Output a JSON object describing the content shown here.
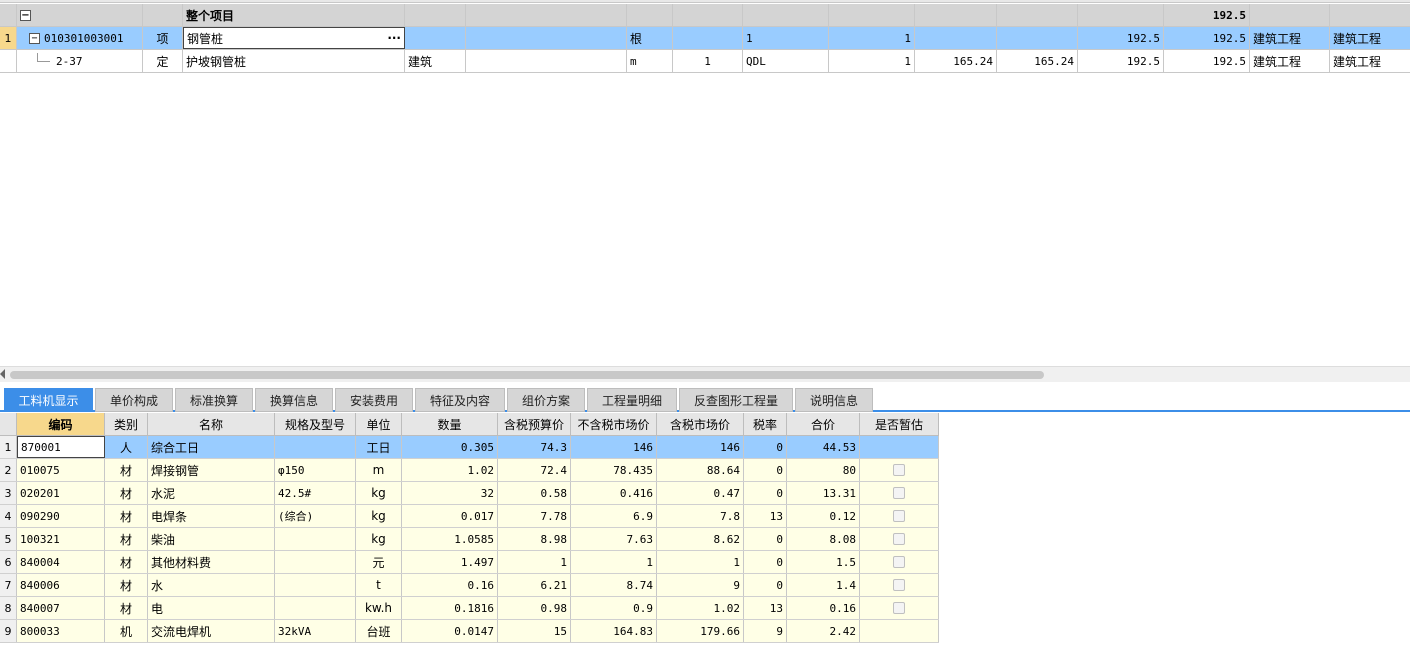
{
  "top_grid": {
    "summary_row": {
      "name": "整个项目",
      "total": "192.5"
    },
    "rows": [
      {
        "num": "1",
        "code": "010301003001",
        "type": "项",
        "name": "钢管桩",
        "ellipsis": "···",
        "spec": "",
        "extra": "",
        "unit": "根",
        "qty_expr": "",
        "qty": "1",
        "qty2": "1",
        "p1": "",
        "p2": "",
        "p3": "192.5",
        "p4": "192.5",
        "cat1": "建筑工程",
        "cat2": "建筑工程"
      },
      {
        "num": "",
        "code": "2-37",
        "type": "定",
        "name": "护坡钢管桩",
        "ellipsis": "",
        "spec": "建筑",
        "extra": "",
        "unit": "m",
        "qty_expr": "1",
        "qty": "QDL",
        "qty2": "1",
        "p1": "165.24",
        "p2": "165.24",
        "p3": "192.5",
        "p4": "192.5",
        "cat1": "建筑工程",
        "cat2": "建筑工程"
      }
    ]
  },
  "tabs": [
    "工料机显示",
    "单价构成",
    "标准换算",
    "换算信息",
    "安装费用",
    "特征及内容",
    "组价方案",
    "工程量明细",
    "反查图形工程量",
    "说明信息"
  ],
  "bottom_grid": {
    "headers": [
      "",
      "编码",
      "类别",
      "名称",
      "规格及型号",
      "单位",
      "数量",
      "含税预算价",
      "不含税市场价",
      "含税市场价",
      "税率",
      "合价",
      "是否暂估"
    ],
    "rows": [
      [
        "1",
        "870001",
        "人",
        "综合工日",
        "",
        "工日",
        "0.305",
        "74.3",
        "146",
        "146",
        "0",
        "44.53",
        ""
      ],
      [
        "2",
        "010075",
        "材",
        "焊接钢管",
        "φ150",
        "m",
        "1.02",
        "72.4",
        "78.435",
        "88.64",
        "0",
        "80",
        "chk"
      ],
      [
        "3",
        "020201",
        "材",
        "水泥",
        "42.5#",
        "kg",
        "32",
        "0.58",
        "0.416",
        "0.47",
        "0",
        "13.31",
        "chk"
      ],
      [
        "4",
        "090290",
        "材",
        "电焊条",
        "(综合)",
        "kg",
        "0.017",
        "7.78",
        "6.9",
        "7.8",
        "13",
        "0.12",
        "chk"
      ],
      [
        "5",
        "100321",
        "材",
        "柴油",
        "",
        "kg",
        "1.0585",
        "8.98",
        "7.63",
        "8.62",
        "0",
        "8.08",
        "chk"
      ],
      [
        "6",
        "840004",
        "材",
        "其他材料费",
        "",
        "元",
        "1.497",
        "1",
        "1",
        "1",
        "0",
        "1.5",
        "chk"
      ],
      [
        "7",
        "840006",
        "材",
        "水",
        "",
        "t",
        "0.16",
        "6.21",
        "8.74",
        "9",
        "0",
        "1.4",
        "chk"
      ],
      [
        "8",
        "840007",
        "材",
        "电",
        "",
        "kw.h",
        "0.1816",
        "0.98",
        "0.9",
        "1.02",
        "13",
        "0.16",
        "chk"
      ],
      [
        "9",
        "800033",
        "机",
        "交流电焊机",
        "32kVA",
        "台班",
        "0.0147",
        "15",
        "164.83",
        "179.66",
        "9",
        "2.42",
        ""
      ]
    ]
  }
}
